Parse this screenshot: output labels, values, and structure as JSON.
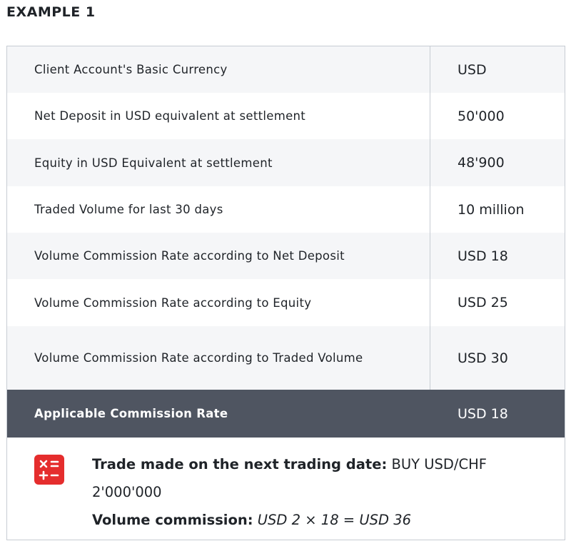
{
  "heading": "EXAMPLE 1",
  "rows": [
    {
      "label": "Client Account's Basic Currency",
      "value": "USD"
    },
    {
      "label": "Net Deposit in USD equivalent at settlement",
      "value": "50'000"
    },
    {
      "label": "Equity in USD Equivalent at settlement",
      "value": "48'900"
    },
    {
      "label": "Traded Volume for last 30 days",
      "value": "10 million"
    },
    {
      "label": "Volume Commission Rate according to Net Deposit",
      "value": "USD 18"
    },
    {
      "label": "Volume Commission Rate according to Equity",
      "value": "USD 25"
    },
    {
      "label": "Volume Commission Rate according to Traded Volume",
      "value": "USD 30"
    }
  ],
  "summary": {
    "label": "Applicable Commission Rate",
    "value": "USD 18"
  },
  "note": {
    "icon": "calculator-icon",
    "trade_label": "Trade made on the next trading date:",
    "trade_value": "BUY USD/CHF 2'000'000",
    "commission_label": "Volume commission:",
    "commission_value": "USD 2 × 18 = USD 36"
  },
  "colors": {
    "summary_bg": "#4f5561",
    "stripe_bg": "#f5f6f8",
    "border": "#c7ccd3",
    "icon_bg": "#e52d2d"
  }
}
